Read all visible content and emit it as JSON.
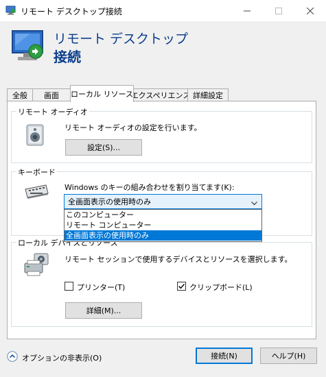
{
  "window": {
    "title": "リモート デスクトップ接続"
  },
  "banner": {
    "line1": "リモート デスクトップ",
    "line2": "接続"
  },
  "tabs": [
    {
      "label": "全般",
      "active": false
    },
    {
      "label": "画面",
      "active": false
    },
    {
      "label": "ローカル リソース",
      "active": true
    },
    {
      "label": "エクスペリエンス",
      "active": false
    },
    {
      "label": "詳細設定",
      "active": false
    }
  ],
  "audio": {
    "group_title": "リモート オーディオ",
    "description": "リモート オーディオの設定を行います。",
    "settings_button": "設定(S)..."
  },
  "keyboard": {
    "group_title": "キーボード",
    "description": "Windows のキーの組み合わせを割り当てます(K):",
    "selected": "全画面表示の使用時のみ",
    "options": [
      {
        "label": "このコンピューター",
        "selected": false
      },
      {
        "label": "リモート コンピューター",
        "selected": false
      },
      {
        "label": "全画面表示の使用時のみ",
        "selected": true
      }
    ]
  },
  "devices": {
    "group_title": "ローカル デバイスとリソース",
    "description": "リモート セッションで使用するデバイスとリソースを選択します。",
    "printer_label": "プリンター(T)",
    "printer_checked": false,
    "clipboard_label": "クリップボード(L)",
    "clipboard_checked": true,
    "details_button": "詳細(M)..."
  },
  "footer": {
    "hide_options": "オプションの非表示(O)",
    "connect_button": "接続(N)",
    "help_button": "ヘルプ(H)"
  },
  "colors": {
    "accent": "#0078d7",
    "banner_text": "#0a3e8c"
  },
  "icons": {
    "app": "remote-desktop-icon",
    "audio": "speaker-icon",
    "keyboard": "keyboard-icon",
    "devices": "printer-camera-icon"
  }
}
